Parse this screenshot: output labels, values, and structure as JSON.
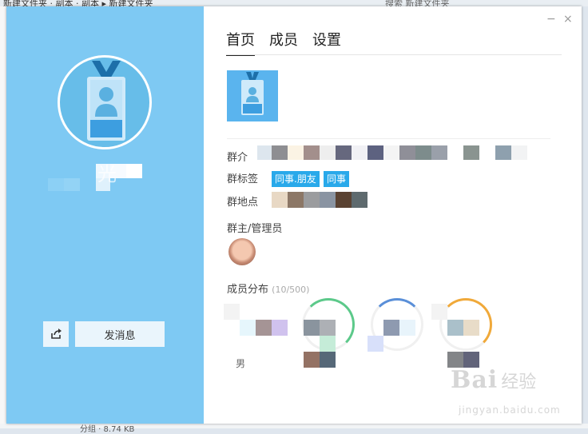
{
  "background": {
    "top_path": "新建文件夹 · 副本 · 副本 ▸ 新建文件夹",
    "top_search": "搜索 新建文件夹",
    "bottom_text": "分组 · 8.74 KB"
  },
  "profile": {
    "name_suffix": "光",
    "share_icon": "share-icon",
    "send_message_label": "发消息"
  },
  "window_controls": {
    "minimize": "−",
    "close": "×"
  },
  "tabs": [
    {
      "label": "首页",
      "active": true
    },
    {
      "label": "成员",
      "active": false
    },
    {
      "label": "设置",
      "active": false
    }
  ],
  "info": {
    "intro_label": "群介",
    "tags_label": "群标签",
    "tags": [
      "同事.朋友",
      "同事"
    ],
    "location_label": "群地点",
    "owner_label": "群主/管理员",
    "distribution_label": "成员分布",
    "distribution_count": "(10/500)",
    "gender_label": "男"
  },
  "watermark": {
    "logo": "Bai",
    "logo_cn": "经验",
    "url": "jingyan.baidu.com"
  },
  "colors": {
    "left_panel": "#7ec9f3",
    "tag_bg": "#29a9ea",
    "accent_ring_green": "#5cc98a",
    "accent_ring_blue": "#5a8fd8",
    "accent_ring_orange": "#f0a93a"
  }
}
